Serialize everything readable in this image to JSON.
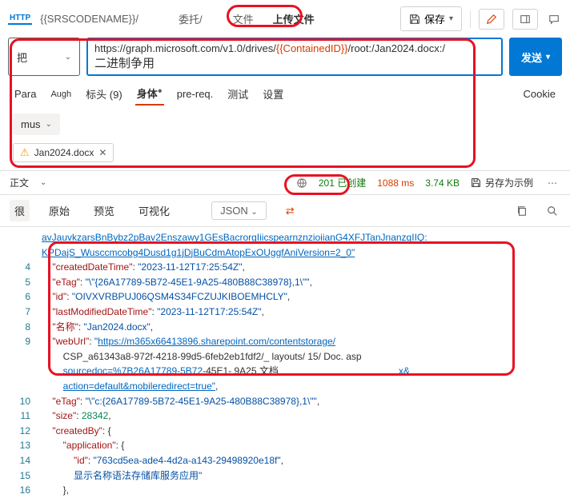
{
  "topbar": {
    "http": "HTTP",
    "codename": "{{SRSCODENAME}}/",
    "crumb1": "委托/",
    "crumb2": "文件",
    "crumb3": "上传文件",
    "save": "保存"
  },
  "request": {
    "method": "把",
    "url_prefix": "https://graph.microsoft.com/v1.0/drives/",
    "url_var": "{{ContainedID}}",
    "url_suffix": "/root:/Jan2024.docx:/",
    "url_sub": "二进制争用",
    "send": "发送"
  },
  "reqtabs": {
    "para": "Para",
    "auth": "Augh",
    "headers": "标头 (9)",
    "body": "身体",
    "prereq": "pre-req.",
    "tests": "测试",
    "settings": "设置",
    "cookie": "Cookie"
  },
  "body_dd": "mus",
  "file_chip": "Jan2024.docx",
  "respbar": {
    "label": "正文",
    "status_code": "201",
    "status_text": "已创建",
    "time": "1088 ms",
    "size": "3.74 KB",
    "save_example": "另存为示例"
  },
  "resptabs": {
    "pretty": "很",
    "raw": "原始",
    "preview": "预览",
    "visualize": "可视化",
    "json": "JSON"
  },
  "code": {
    "l3_part": "avJauvkzarsBnBybz2pBav2Enszawy1GEsBacrorgIiicspearnznzioiianG4XFJTanJnanzgIIQ:",
    "l3b": "KPDajS_Wusccmcobg4Dusd1g1jDjBuCdmAtopExOUggfAniVersion=2_0\"",
    "l4k": "\"createdDateTime\"",
    "l4v": "\"2023-11-12T17:25:54Z\"",
    "l5k": "\"eTag\"",
    "l5v": "\"\\\"{26A17789-5B72-45E1-9A25-480B88C38978},1\\\"\"",
    "l6k": "\"id\"",
    "l6v": "\"OIVXVRBPUJ06QSM4S34FCZUJKIBOEMHCLY\"",
    "l7k": "\"lastModifiedDateTime\"",
    "l7v": "\"2023-11-12T17:25:54Z\"",
    "l8k": "\"名称\"",
    "l8v": "\"Jan2024.docx\"",
    "l9k": "\"webUrl\"",
    "l9v1": "https://m365x66413896.sharepoint.com/contentstorage/",
    "l9a": "CSP_a61343a8-972f-4218-99d5-6feb2eb1fdf2/_ layouts/ 15/ Doc. asp",
    "l9b1": "sourcedoc=%7B26A17789-5B72",
    "l9b2": "-45E1- 9A25 文档",
    "l9b3": "x&",
    "l9c": "action=default&mobileredirect=true\"",
    "l10k": "\"eTag\"",
    "l10v": "\"\\\"c:{26A17789-5B72-45E1-9A25-480B88C38978},1\\\"\"",
    "l11k": "\"size\"",
    "l11v": "28342",
    "l12k": "\"createdBy\"",
    "l13k": "\"application\"",
    "l14k": "\"id\"",
    "l14v": "\"763cd5ea-ade4-4d2a-a143-29498920e18f\"",
    "l15": "显示名称语法存储库服务应用\""
  }
}
